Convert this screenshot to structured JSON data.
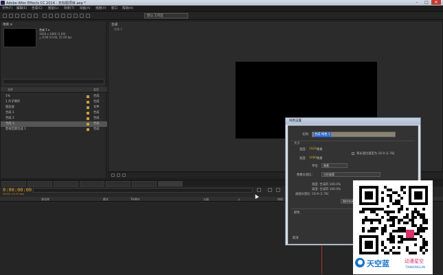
{
  "window": {
    "title": "Adobe After Effects CC 2014 - 无标题项目.aep *",
    "minimize": "–",
    "maximize": "□",
    "close": "✕"
  },
  "menu": [
    "文件(F)",
    "编辑(E)",
    "合成(C)",
    "图层(L)",
    "效果(T)",
    "动画(A)",
    "视图(V)",
    "窗口",
    "帮助(H)"
  ],
  "toolbar": {
    "workspace": "默认 工作区"
  },
  "project": {
    "tab": "项目 ≡",
    "comp_name": "合成 1 ▾",
    "comp_size": "1920 x 1080 (1.00)",
    "comp_duration": "△ 0:00:10:00, 25.00 fps",
    "col_name": "名称",
    "col_type": "类型",
    "items": [
      {
        "name": "1%",
        "type": "合成",
        "color": "#c8a040"
      },
      {
        "name": "1 片子制作",
        "type": "合成",
        "color": "#c8a040"
      },
      {
        "name": "固态层",
        "type": "文件",
        "color": "#c8a040"
      },
      {
        "name": "合成 1",
        "type": "合成",
        "color": "#c8a040"
      },
      {
        "name": "合成 2",
        "type": "合成",
        "color": "#c8a040"
      },
      {
        "name": "合成 3",
        "type": "合成",
        "color": "#c8a040",
        "selected": true
      },
      {
        "name": "影视后期合成 1",
        "type": "合成",
        "color": "#c8a040"
      }
    ],
    "bpc": "8 bpc"
  },
  "viewer": {
    "tab": "合成: ",
    "sub": "合成 1"
  },
  "timeline": {
    "timecode": "0:00:00:00",
    "fps": "00000 (25.00 fps)",
    "columns": {
      "layer_name": "源名称",
      "mode": "模式",
      "trkmat": "TrkMat",
      "parent": "父级",
      "in": "入",
      "duration": "持续"
    }
  },
  "dialog": {
    "title": "纯色设置",
    "name_label": "名称:",
    "name_value": "合成 纯色 1",
    "size_label": "大小",
    "width_label": "宽度:",
    "width_value": "1920",
    "width_unit": "像素",
    "height_label": "高度:",
    "height_value": "1080",
    "height_unit": "像素",
    "lock_label": "将长宽比锁定为 16:9 (1.78)",
    "units_label": "单位:",
    "units_value": "像素",
    "pixel_aspect_label": "像素长宽比:",
    "pixel_aspect_value": "方形像素",
    "width_pct": "宽度: 合成的 100.0%",
    "height_pct": "高度: 合成的 100.0%",
    "frame_aspect": "画面长宽比: 16:9 (1.78)",
    "make_comp_size": "制作合成大小",
    "color_label": "颜色",
    "cancel": "取消"
  },
  "watermark": {
    "brand": "天空蓝",
    "side": "动漫星空",
    "sub": "TIANKONGLAN"
  }
}
